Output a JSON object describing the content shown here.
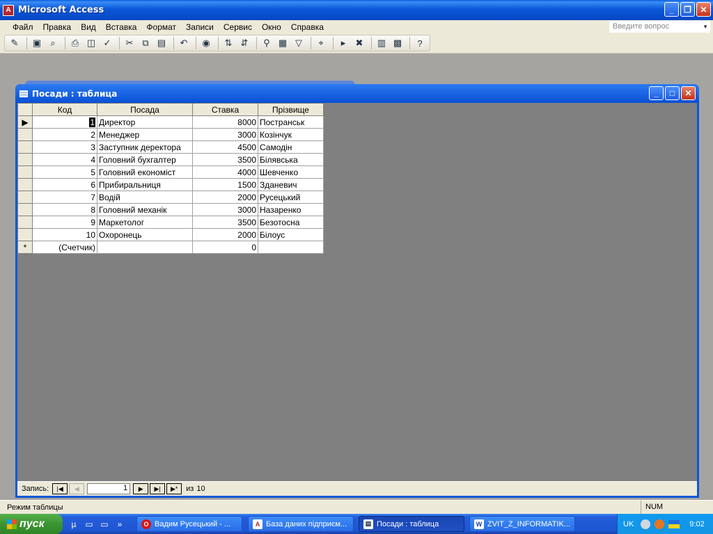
{
  "app": {
    "title": "Microsoft Access",
    "brand_color": "#b4262a"
  },
  "menu": {
    "items": [
      "Файл",
      "Правка",
      "Вид",
      "Вставка",
      "Формат",
      "Записи",
      "Сервис",
      "Окно",
      "Справка"
    ],
    "ask_placeholder": "Введите вопрос"
  },
  "toolbar_icons": [
    "design-view-icon",
    "save-icon",
    "search-file-icon",
    "print-icon",
    "print-preview-icon",
    "spelling-icon",
    "cut-icon",
    "copy-icon",
    "paste-icon",
    "undo-icon",
    "insert-hyperlink-icon",
    "sort-ascending-icon",
    "sort-descending-icon",
    "filter-by-selection-icon",
    "filter-by-form-icon",
    "apply-filter-icon",
    "find-icon",
    "new-record-icon",
    "delete-record-icon",
    "database-window-icon",
    "new-object-icon",
    "help-icon"
  ],
  "table_window": {
    "title": "Посади : таблица",
    "columns": [
      "Код",
      "Посада",
      "Ставка",
      "Прізвище"
    ],
    "rows": [
      {
        "kod": "1",
        "posada": "Директор",
        "stavka": "8000",
        "prizv": "Постранськ"
      },
      {
        "kod": "2",
        "posada": "Менеджер",
        "stavka": "3000",
        "prizv": "Козінчук"
      },
      {
        "kod": "3",
        "posada": "Заступник деректора",
        "stavka": "4500",
        "prizv": "Самодін"
      },
      {
        "kod": "4",
        "posada": "Головний бухгалтер",
        "stavka": "3500",
        "prizv": "Білявська"
      },
      {
        "kod": "5",
        "posada": "Головний економіст",
        "stavka": "4000",
        "prizv": "Шевченко"
      },
      {
        "kod": "6",
        "posada": "Прибиральниця",
        "stavka": "1500",
        "prizv": "Зданевич"
      },
      {
        "kod": "7",
        "posada": "Водій",
        "stavka": "2000",
        "prizv": "Русецький"
      },
      {
        "kod": "8",
        "posada": "Головний механік",
        "stavka": "3000",
        "prizv": "Назаренко"
      },
      {
        "kod": "9",
        "posada": "Маркетолог",
        "stavka": "3500",
        "prizv": "Безотосна"
      },
      {
        "kod": "10",
        "posada": "Охоронець",
        "stavka": "2000",
        "prizv": "Білоус"
      }
    ],
    "new_row": {
      "marker": "*",
      "kod": "(Счетчик)",
      "stavka": "0"
    },
    "current_marker": "▶"
  },
  "navigator": {
    "label": "Запись:",
    "current": "1",
    "of_label": "из",
    "total": "10"
  },
  "status": {
    "mode": "Режим таблицы",
    "num": "NUM"
  },
  "taskbar": {
    "start": "пуск",
    "tasks": [
      {
        "label": "Вадим Русецький - ...",
        "icon": "opera-icon"
      },
      {
        "label": "База даних підприєм...",
        "icon": "access-db-icon"
      },
      {
        "label": "Посади : таблица",
        "icon": "table-icon"
      },
      {
        "label": "ZVIT_Z_INFORMATIK...",
        "icon": "word-icon"
      }
    ],
    "lang": "UK",
    "clock": "9:02"
  }
}
